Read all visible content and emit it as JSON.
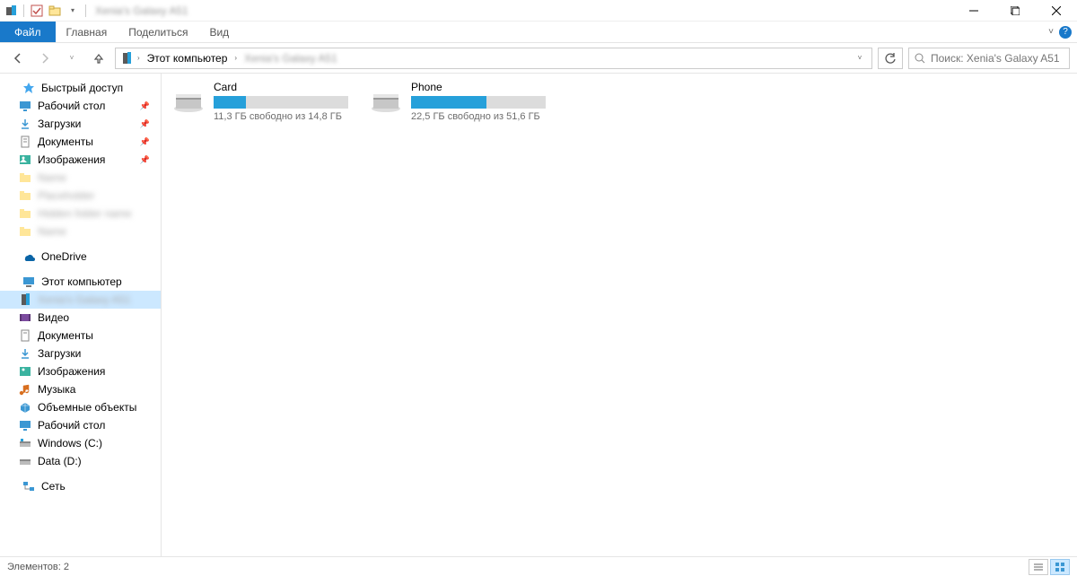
{
  "title_blur": "Xenia's Galaxy A51",
  "ribbon": {
    "file": "Файл",
    "home": "Главная",
    "share": "Поделиться",
    "view": "Вид"
  },
  "nav": {
    "crumb_root": "Этот компьютер",
    "crumb_blur": "Xenia's Galaxy A51"
  },
  "search": {
    "placeholder": "Поиск: Xenia's Galaxy A51"
  },
  "sidebar": {
    "quick": "Быстрый доступ",
    "desktop": "Рабочий стол",
    "downloads": "Загрузки",
    "documents": "Документы",
    "pictures": "Изображения",
    "blur1": "Name",
    "blur2": "Placeholder",
    "blur3": "Hidden folder name",
    "blur4": "Name",
    "onedrive": "OneDrive",
    "thispc": "Этот компьютер",
    "device_blur": "Xenia's Galaxy A51",
    "video": "Видео",
    "documents2": "Документы",
    "downloads2": "Загрузки",
    "pictures2": "Изображения",
    "music": "Музыка",
    "volumes": "Объемные объекты",
    "desktop2": "Рабочий стол",
    "windows_c": "Windows (C:)",
    "data_d": "Data (D:)",
    "network": "Сеть"
  },
  "drives": [
    {
      "name": "Card",
      "free_text": "11,3 ГБ свободно из 14,8 ГБ",
      "fill_pct": 24
    },
    {
      "name": "Phone",
      "free_text": "22,5 ГБ свободно из 51,6 ГБ",
      "fill_pct": 56
    }
  ],
  "status": {
    "items": "Элементов: 2"
  }
}
